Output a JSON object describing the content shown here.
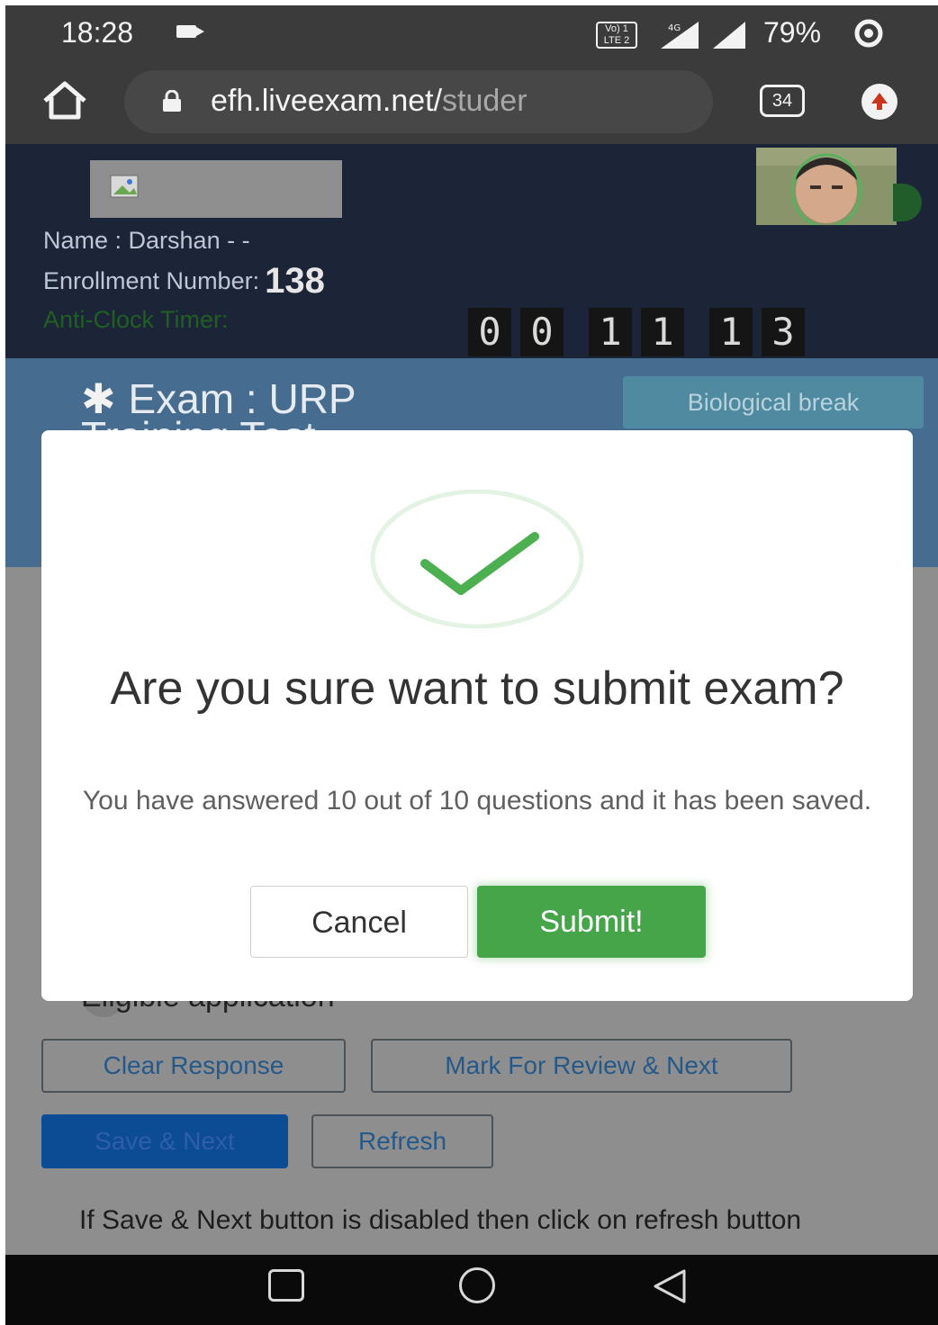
{
  "status_bar": {
    "time": "18:28",
    "volte_label": "Vo) 1 LTE 2",
    "network": "4G",
    "battery": "79%"
  },
  "browser": {
    "url_main": "efh.liveexam.net/",
    "url_tail": "studer",
    "tab_count": "34"
  },
  "header": {
    "name_label": "Name : Darshan - -",
    "enrollment_label": "Enrollment Number:",
    "enrollment_value": "138",
    "timer_label": "Anti-Clock Timer:",
    "timer_digits": [
      "0",
      "0",
      "1",
      "1",
      "1",
      "3"
    ]
  },
  "exam": {
    "title": "Exam : URP",
    "title_cont": "Training Test",
    "break_button": "Biological break"
  },
  "behind": {
    "option_text": "Eligible application",
    "clear_response": "Clear Response",
    "mark_review": "Mark For Review & Next",
    "save_next": "Save & Next",
    "refresh": "Refresh",
    "note": "If Save & Next button is disabled then click on refresh button"
  },
  "modal": {
    "title": "Are you sure want to submit exam?",
    "text": "You have answered 10 out of 10 questions and it has been saved.",
    "cancel": "Cancel",
    "submit": "Submit!"
  },
  "colors": {
    "header_bg": "#1c2437",
    "exam_bar": "#466c8f",
    "success_green": "#45a548",
    "overlay": "#8e8e8e"
  },
  "icons": [
    "home-icon",
    "lock-icon",
    "tabs-icon",
    "upload-icon",
    "checkmark-icon",
    "broken-image-icon",
    "nav-recents-icon",
    "nav-home-icon",
    "nav-back-icon"
  ]
}
